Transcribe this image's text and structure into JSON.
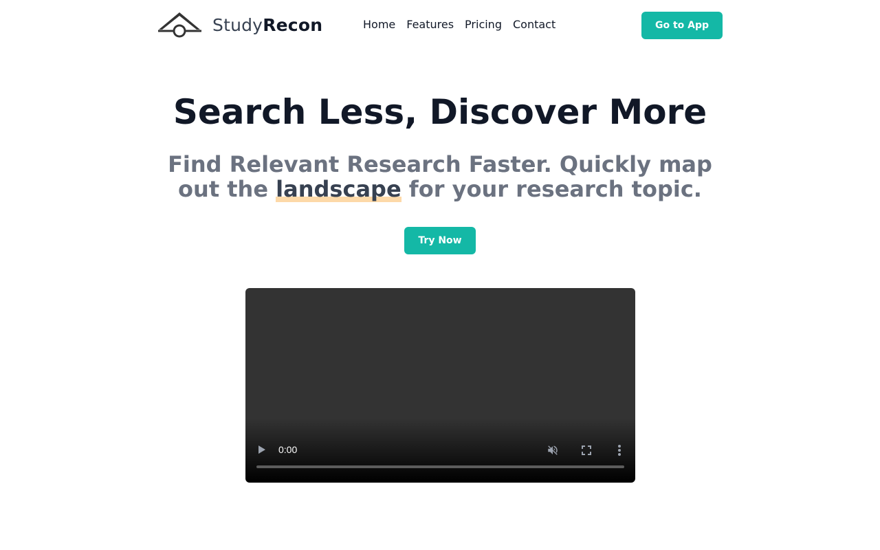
{
  "header": {
    "brand_light": "Study",
    "brand_bold": "Recon",
    "nav": [
      "Home",
      "Features",
      "Pricing",
      "Contact"
    ],
    "cta_label": "Go to App"
  },
  "hero": {
    "title": "Search Less, Discover More",
    "subtitle_before": "Find Relevant Research Faster. Quickly map out the ",
    "subtitle_highlight": "landscape",
    "subtitle_after": " for your research topic.",
    "cta_label": "Try Now"
  },
  "video": {
    "time": "0:00",
    "progress": 0,
    "muted": true,
    "icons": [
      "play-icon",
      "mute-icon",
      "fullscreen-icon",
      "more-options-icon"
    ]
  },
  "colors": {
    "accent": "#14b8a6",
    "highlight": "#fdd9a8",
    "title": "#111827",
    "subtitle": "#6b7280"
  }
}
